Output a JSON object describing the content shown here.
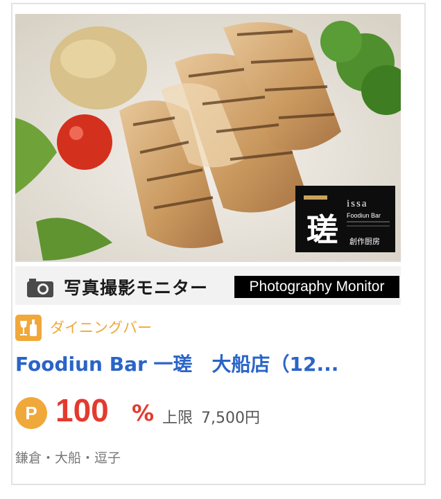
{
  "card": {
    "photo": {
      "alt": "Grilled chicken with vegetables",
      "logo": {
        "latin_text": "issa",
        "sub_text": "Foodiun Bar",
        "kanji": "一瑳",
        "caption": "創作厨房"
      }
    },
    "banner": {
      "jp_text": "写真撮影モニター",
      "en_text": "Photography Monitor"
    },
    "genre": {
      "label": "ダイニングバー",
      "icon": "wine-glass-icon"
    },
    "shop_name": "Foodiun Bar 一瑳　大船店（12...",
    "points": {
      "badge": "P",
      "percent_value": "100",
      "percent_sign": "%",
      "limit_label": "上限",
      "limit_value": "7,500円"
    },
    "area": "鎌倉・大船・逗子"
  },
  "colors": {
    "accent_orange": "#f0a83a",
    "link_blue": "#2a64c8",
    "percent_red": "#e43a2e",
    "muted_text": "#777777"
  }
}
